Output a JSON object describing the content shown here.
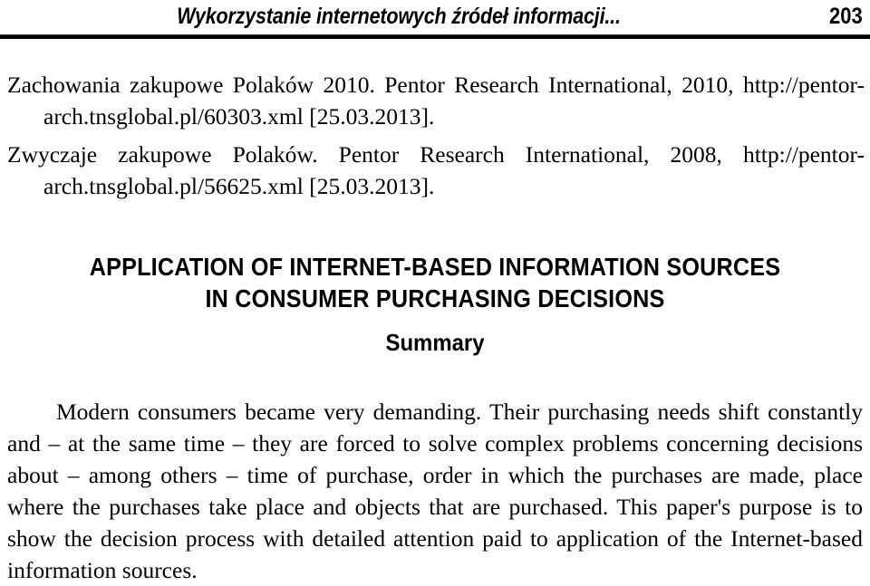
{
  "page": {
    "folio": "203",
    "running_head": "Wykorzystanie internetowych źródeł informacji..."
  },
  "references": [
    {
      "text": "Zachowania zakupowe Polaków 2010. Pentor Research International, 2010, http://pentor-arch.tnsglobal.pl/60303.xml [25.03.2013]."
    },
    {
      "text": "Zwyczaje zakupowe Polaków. Pentor Research International, 2008, http://pentor-arch.tnsglobal.pl/56625.xml [25.03.2013]."
    }
  ],
  "article": {
    "title_line_1": "APPLICATION OF INTERNET-BASED INFORMATION SOURCES",
    "title_line_2": "IN CONSUMER PURCHASING DECISIONS",
    "section_heading": "Summary",
    "abstract": "Modern consumers became very demanding. Their purchasing needs shift constantly and – at the same time – they are forced to solve complex problems concerning decisions about – among others – time of purchase, order in which the purchases are made, place where the purchases take place and objects that are purchased. This paper's purpose is to show the decision process with detailed attention paid to application of the Internet-based information sources."
  },
  "colors": {
    "text": "#000000",
    "background": "#ffffff",
    "rule": "#000000"
  }
}
